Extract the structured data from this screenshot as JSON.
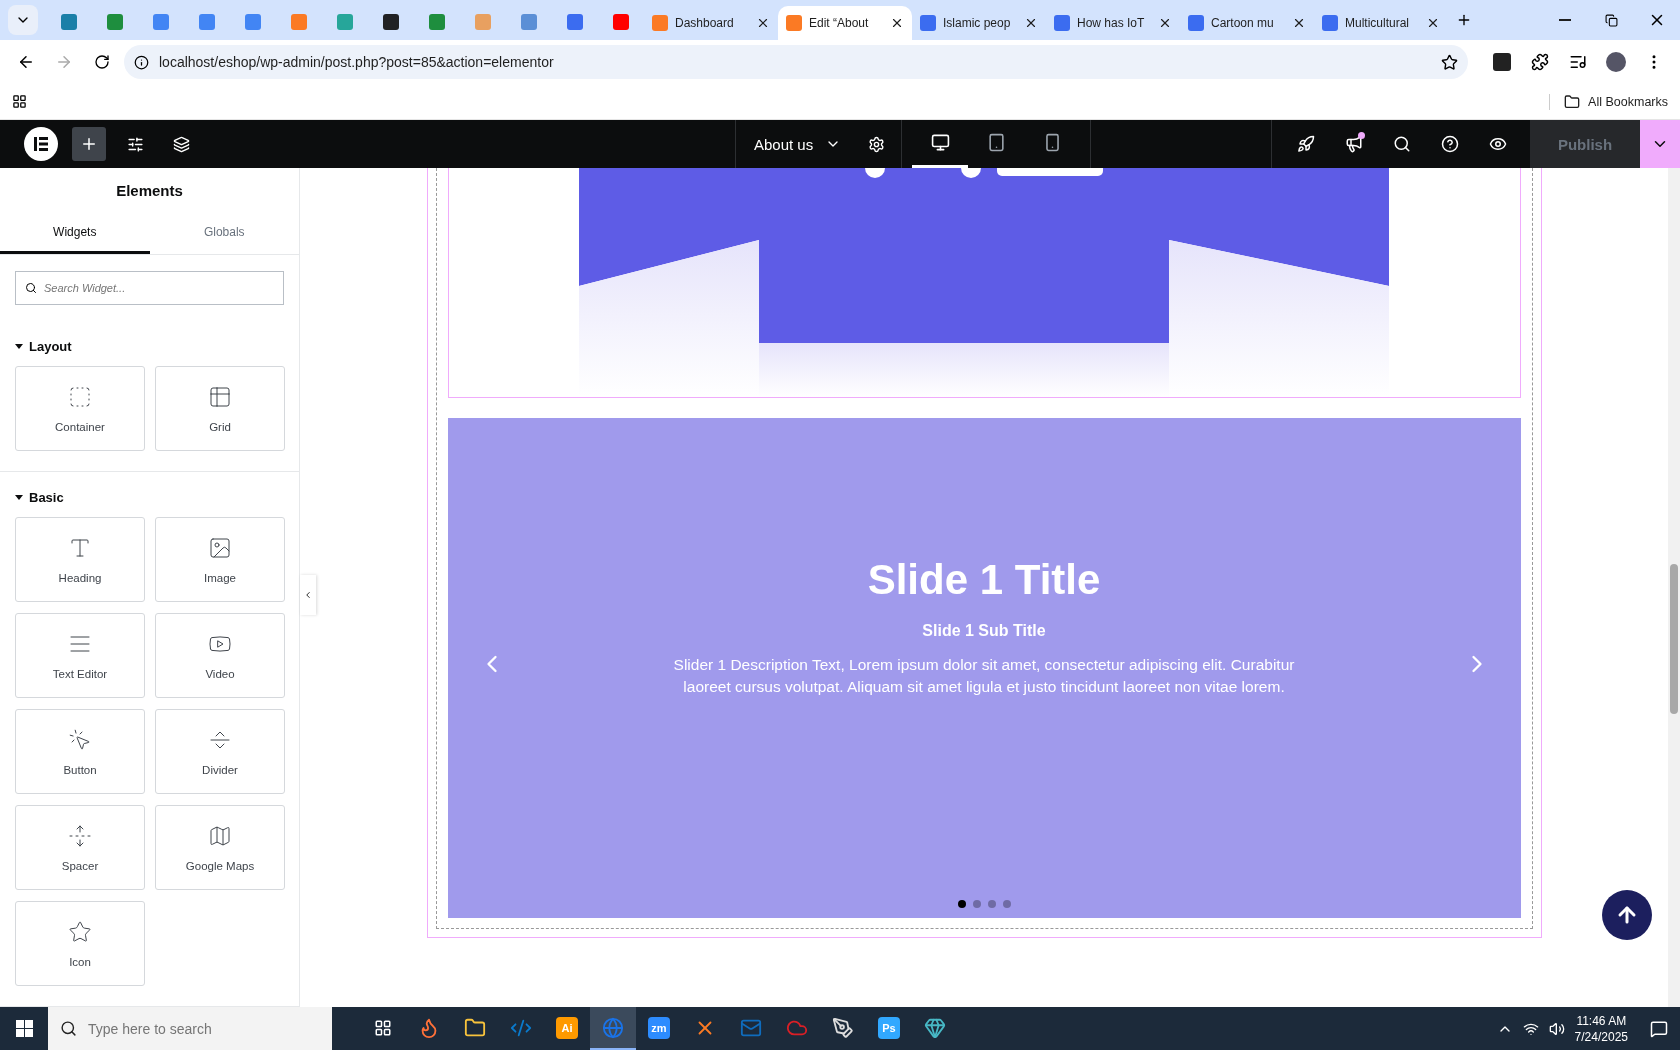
{
  "browser": {
    "tabs": [
      {
        "kind": "icon",
        "color": "#1a7fa8",
        "selected": false
      },
      {
        "kind": "icon",
        "color": "#1e8e3e",
        "selected": false
      },
      {
        "kind": "icon",
        "color": "#4285f4",
        "selected": false
      },
      {
        "kind": "icon",
        "color": "#4285f4",
        "selected": false
      },
      {
        "kind": "icon",
        "color": "#4285f4",
        "selected": false
      },
      {
        "kind": "icon",
        "color": "#fb7a24",
        "selected": false
      },
      {
        "kind": "icon",
        "color": "#26a69a",
        "selected": false
      },
      {
        "kind": "icon",
        "color": "#202124",
        "selected": false
      },
      {
        "kind": "icon",
        "color": "#1e8e3e",
        "selected": false
      },
      {
        "kind": "icon",
        "color": "#e8a060",
        "selected": false
      },
      {
        "kind": "icon",
        "color": "#5b8fd6",
        "selected": false
      },
      {
        "kind": "icon",
        "color": "#3b6cf0",
        "selected": false
      },
      {
        "kind": "icon",
        "color": "#ff0000",
        "selected": false
      },
      {
        "kind": "text",
        "title": "Dashboard",
        "color": "#fb7a24",
        "selected": false
      },
      {
        "kind": "text",
        "title": "Edit “About",
        "color": "#fb7a24",
        "selected": true
      },
      {
        "kind": "text",
        "title": "Islamic peop",
        "color": "#3b6cf0",
        "selected": false
      },
      {
        "kind": "text",
        "title": "How has IoT",
        "color": "#3b6cf0",
        "selected": false
      },
      {
        "kind": "text",
        "title": "Cartoon mu",
        "color": "#3b6cf0",
        "selected": false
      },
      {
        "kind": "text",
        "title": "Multicultural",
        "color": "#3b6cf0",
        "selected": false
      }
    ],
    "address": "localhost/eshop/wp-admin/post.php?post=85&action=elementor",
    "bookmarks": "All Bookmarks"
  },
  "editor": {
    "page_title": "About us",
    "devices": [
      {
        "kind": "desktop",
        "selected": true
      },
      {
        "kind": "tablet",
        "selected": false
      },
      {
        "kind": "mobile",
        "selected": false
      }
    ],
    "publish": {
      "label": "Publish",
      "disabled": true
    }
  },
  "sidebar": {
    "title": "Elements",
    "tabs": [
      {
        "label": "Widgets",
        "selected": true
      },
      {
        "label": "Globals",
        "selected": false
      }
    ],
    "search": {
      "placeholder": "Search Widget..."
    },
    "categories": [
      {
        "name": "Layout",
        "expanded": true,
        "widgets": [
          {
            "kind": "container",
            "label": "Container"
          },
          {
            "kind": "grid",
            "label": "Grid"
          }
        ]
      },
      {
        "name": "Basic",
        "expanded": true,
        "widgets": [
          {
            "kind": "heading",
            "label": "Heading"
          },
          {
            "label": "Image"
          },
          {
            "kind": "text",
            "label": "Text Editor"
          },
          {
            "kind": "video",
            "label": "Video"
          },
          {
            "kind": "button",
            "label": "Button"
          },
          {
            "kind": "divider",
            "label": "Divider"
          },
          {
            "kind": "spacer",
            "label": "Spacer"
          },
          {
            "kind": "map",
            "label": "Google Maps"
          },
          {
            "kind": "icon",
            "label": "Icon"
          }
        ]
      }
    ]
  },
  "canvas": {
    "slider": {
      "title": "Slide 1 Title",
      "subtitle": "Slide 1 Sub Title",
      "description": "Slider 1 Description Text, Lorem ipsum dolor sit amet, consectetur adipiscing elit. Curabitur laoreet cursus volutpat. Aliquam sit amet ligula et justo tincidunt laoreet non vitae lorem.",
      "dots": [
        {
          "selected": true
        },
        {
          "selected": false
        },
        {
          "selected": false
        },
        {
          "selected": false
        }
      ]
    }
  },
  "taskbar": {
    "search_placeholder": "Type here to search",
    "apps": [
      {
        "kind": "firefox",
        "color": "#ff7139",
        "selected": false
      },
      {
        "kind": "folder",
        "color": "#f8c33c",
        "selected": false
      },
      {
        "kind": "vscode",
        "color": "#0a7acc",
        "selected": false
      },
      {
        "kind": "label",
        "label": "Ai",
        "color": "#ff9a00",
        "selected": false
      },
      {
        "kind": "chrome",
        "color": "#1a73e8",
        "selected": true
      },
      {
        "kind": "label",
        "label": "zm",
        "color": "#2d8cff",
        "selected": false
      },
      {
        "kind": "xampp",
        "color": "#fb7a24",
        "selected": false
      },
      {
        "kind": "outlook",
        "color": "#0f6cbd",
        "selected": false
      },
      {
        "kind": "cloud",
        "color": "#da1f26",
        "selected": false
      },
      {
        "kind": "pen",
        "color": "#dddddd",
        "selected": false
      },
      {
        "kind": "label",
        "label": "Ps",
        "color": "#31a8ff",
        "selected": false
      },
      {
        "kind": "gem",
        "color": "#47b8c5",
        "selected": false
      }
    ],
    "time": "11:46 AM",
    "date": "7/24/2025"
  }
}
